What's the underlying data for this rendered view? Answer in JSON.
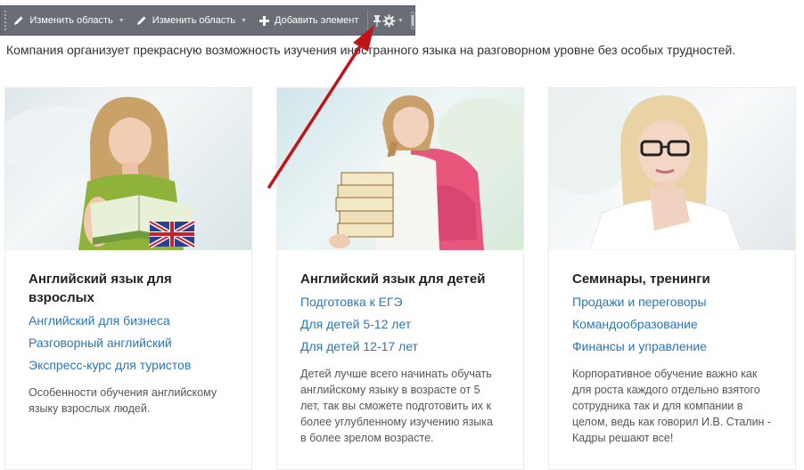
{
  "toolbar": {
    "edit_area_1": "Изменить область",
    "edit_area_2": "Изменить область",
    "add_element": "Добавить элемент",
    "pin_icon": "pin-icon",
    "settings_icon": "gear-icon"
  },
  "intro_text": "Компания организует прекрасную возможность изучения иностранного языка на разговорном уровне без особых трудностей.",
  "cards": [
    {
      "title": "Английский язык для взрослых",
      "links": [
        "Английский для бизнеса",
        "Разговорный английский",
        "Экспресс-курс для туристов"
      ],
      "description": "Особенности обучения английскому языку взрослых людей."
    },
    {
      "title": "Английский язык для детей",
      "links": [
        "Подготовка к ЕГЭ",
        "Для детей 5-12 лет",
        "Для детей 12-17 лет"
      ],
      "description": "Детей лучше всего начинать обучать английскому языку в возрасте от 5 лет, так вы сможете подготовить их к более углубленному изучению языка в более зрелом возрасте."
    },
    {
      "title": "Семинары, тренинги",
      "links": [
        "Продажи и переговоры",
        "Командообразование",
        "Финансы и управление"
      ],
      "description": "Корпоративное обучение важно как для роста каждого отдельно взятого сотрудника так и для компании в целом, ведь как говорил И.В. Сталин - Кадры решают все!"
    }
  ],
  "colors": {
    "toolbar_bg": "#696e76",
    "link": "#2a77b9",
    "arrow": "#c0141b"
  }
}
